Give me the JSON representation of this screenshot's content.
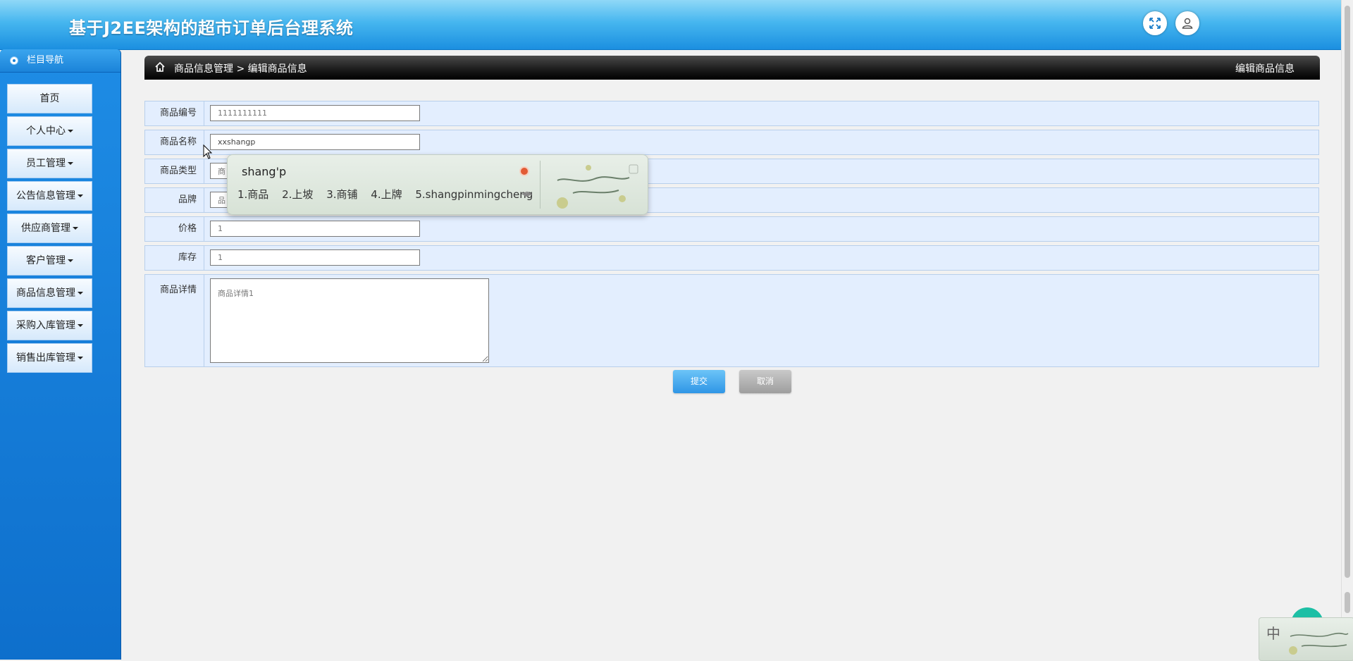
{
  "header": {
    "title": "基于J2EE架构的超市订单后台理系统"
  },
  "sidebar": {
    "nav_title": "栏目导航",
    "items": [
      {
        "label": "首页",
        "has_caret": false
      },
      {
        "label": "个人中心",
        "has_caret": true
      },
      {
        "label": "员工管理",
        "has_caret": true
      },
      {
        "label": "公告信息管理",
        "has_caret": true
      },
      {
        "label": "供应商管理",
        "has_caret": true
      },
      {
        "label": "客户管理",
        "has_caret": true
      },
      {
        "label": "商品信息管理",
        "has_caret": true
      },
      {
        "label": "采购入库管理",
        "has_caret": true
      },
      {
        "label": "销售出库管理",
        "has_caret": true
      }
    ]
  },
  "breadcrumb": {
    "section": "商品信息管理",
    "separator": ">",
    "page": "编辑商品信息",
    "right_title": "编辑商品信息"
  },
  "form": {
    "fields": [
      {
        "label": "商品编号",
        "value": "1111111111"
      },
      {
        "label": "商品名称",
        "value": "xxshangp"
      },
      {
        "label": "商品类型",
        "value": "商"
      },
      {
        "label": "品牌",
        "value": "品"
      },
      {
        "label": "价格",
        "value": "1"
      },
      {
        "label": "库存",
        "value": "1"
      }
    ],
    "detail": {
      "label": "商品详情",
      "value": "商品详情1"
    },
    "submit_label": "提交",
    "cancel_label": "取消"
  },
  "ime": {
    "pinyin": "shang'p",
    "candidates": [
      "1.商品",
      "2.上坡",
      "3.商铺",
      "4.上牌",
      "5.shangpinmingcheng"
    ]
  },
  "tray": {
    "mode": "中"
  },
  "colors": {
    "header_blue": "#1b8fe0",
    "sidebar_blue": "#0e6fcc",
    "form_bg": "#e3eefe",
    "submit": "#2f96e6",
    "cancel": "#9e9e9e"
  }
}
